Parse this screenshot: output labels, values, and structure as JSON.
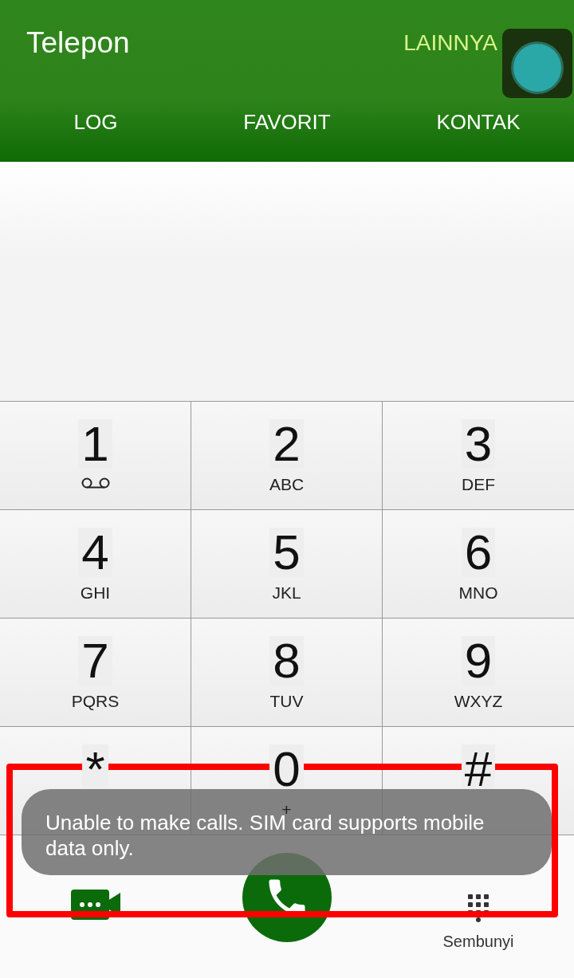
{
  "app_bar": {
    "title": "Telepon",
    "menu": "LAINNYA"
  },
  "tabs": [
    {
      "label": "LOG"
    },
    {
      "label": "FAVORIT"
    },
    {
      "label": "KONTAK"
    }
  ],
  "keys": [
    {
      "digit": "1",
      "kind": "voicemail"
    },
    {
      "digit": "2",
      "kind": "letters",
      "letters": "ABC"
    },
    {
      "digit": "3",
      "kind": "letters",
      "letters": "DEF"
    },
    {
      "digit": "4",
      "kind": "letters",
      "letters": "GHI"
    },
    {
      "digit": "5",
      "kind": "letters",
      "letters": "JKL"
    },
    {
      "digit": "6",
      "kind": "letters",
      "letters": "MNO"
    },
    {
      "digit": "7",
      "kind": "letters",
      "letters": "PQRS"
    },
    {
      "digit": "8",
      "kind": "letters",
      "letters": "TUV"
    },
    {
      "digit": "9",
      "kind": "letters",
      "letters": "WXYZ"
    },
    {
      "digit": "*",
      "kind": "plain"
    },
    {
      "digit": "0",
      "kind": "letters",
      "letters": "+"
    },
    {
      "digit": "#",
      "kind": "plain"
    }
  ],
  "bottom_bar": {
    "hide_label": "Sembunyi"
  },
  "toast": {
    "message": "Unable to make calls. SIM card supports mobile data only."
  }
}
